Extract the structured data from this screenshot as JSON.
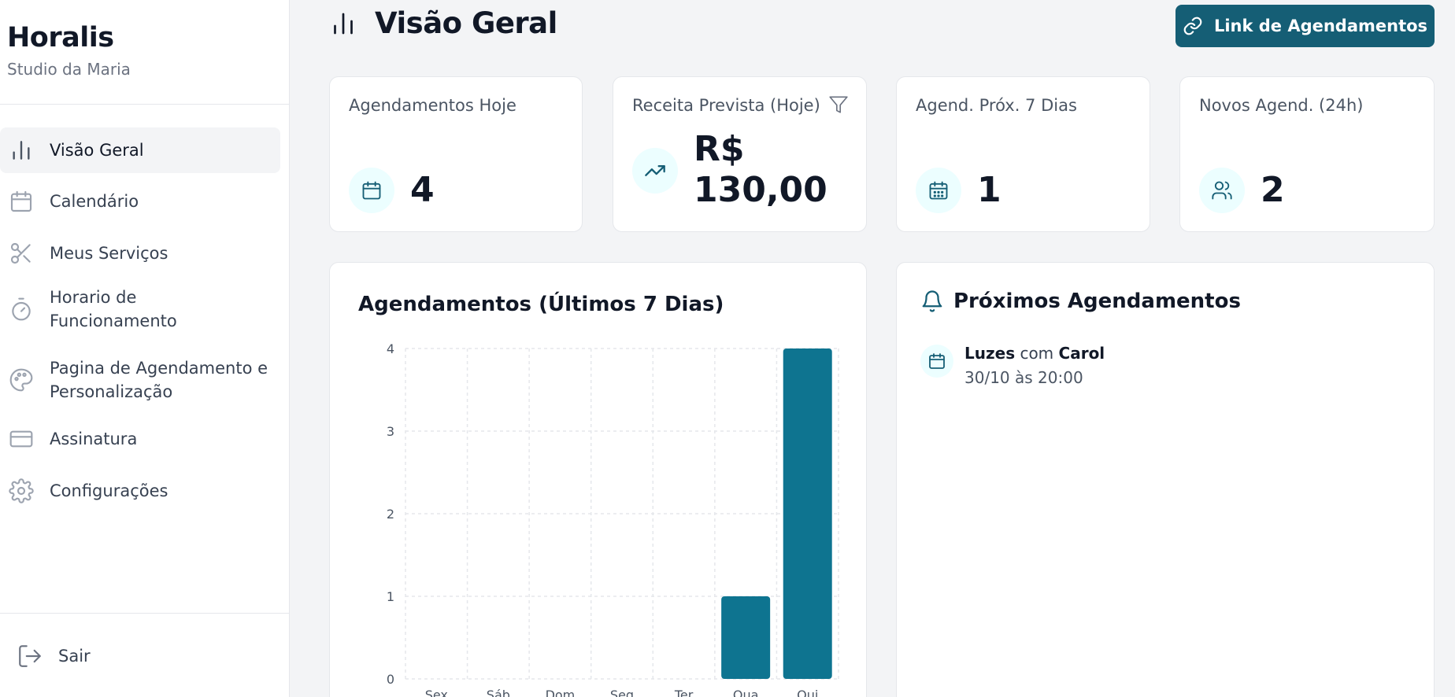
{
  "sidebar": {
    "brand": "Horalis",
    "studio": "Studio da Maria",
    "items": [
      {
        "label": "Visão Geral",
        "icon": "bar-chart-icon"
      },
      {
        "label": "Calendário",
        "icon": "calendar-icon"
      },
      {
        "label": "Meus Serviços",
        "icon": "scissors-icon"
      },
      {
        "label": "Horario de Funcionamento",
        "icon": "timer-icon"
      },
      {
        "label": "Pagina de Agendamento e Personalização",
        "icon": "palette-icon"
      },
      {
        "label": "Assinatura",
        "icon": "credit-card-icon"
      },
      {
        "label": "Configurações",
        "icon": "gear-icon"
      }
    ],
    "logout": "Sair"
  },
  "header": {
    "title": "Visão Geral",
    "link_button": "Link de Agendamentos"
  },
  "stats": [
    {
      "label": "Agendamentos Hoje",
      "value": "4"
    },
    {
      "label": "Receita Prevista (Hoje)",
      "value_line1": "R$",
      "value_line2": "130,00"
    },
    {
      "label": "Agend. Próx. 7 Dias",
      "value": "1"
    },
    {
      "label": "Novos Agend. (24h)",
      "value": "2"
    }
  ],
  "chart_data": {
    "type": "bar",
    "title": "Agendamentos (Últimos 7 Dias)",
    "categories": [
      "Sex",
      "Sáb",
      "Dom",
      "Seg",
      "Ter",
      "Qua",
      "Qui"
    ],
    "values": [
      0,
      0,
      0,
      0,
      0,
      1,
      4
    ],
    "yticks": [
      "0",
      "1",
      "2",
      "3",
      "4"
    ],
    "ylim": [
      0,
      4
    ],
    "grid": true,
    "bar_color": "#0e7490"
  },
  "upcoming": {
    "title": "Próximos Agendamentos",
    "items": [
      {
        "service": "Luzes",
        "connector": "com",
        "client": "Carol",
        "when": "30/10 às 20:00"
      }
    ]
  },
  "colors": {
    "accent": "#155e75",
    "icon_bg": "#ecfeff"
  }
}
